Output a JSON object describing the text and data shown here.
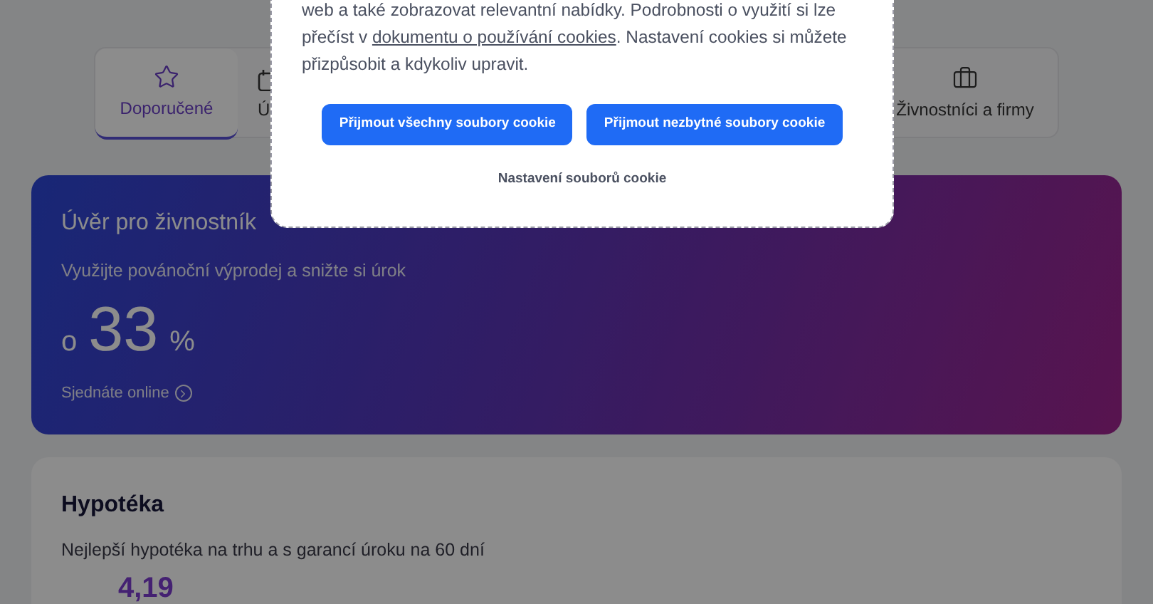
{
  "tabs": [
    {
      "label": "Doporučené",
      "selected": true
    },
    {
      "label": "Ú",
      "selected": false
    },
    {
      "label": "Živnostníci a firmy",
      "selected": false
    }
  ],
  "promo_card": {
    "title": "Úvěr pro živnostník",
    "subtitle": "Využijte povánoční výprodej a snižte si úrok",
    "prefix": "o",
    "value": "33",
    "unit": "%",
    "link": "Sjednáte online"
  },
  "mortgage_card": {
    "title": "Hypotéka",
    "subtitle": "Nejlepší hypotéka na trhu a s garancí úroku na 60 dní",
    "value": "4,19"
  },
  "cookie_dialog": {
    "text_before": "web a také zobrazovat relevantní nabídky. Podrobnosti o využití si lze přečíst v ",
    "link": "dokumentu o používání cookies",
    "text_after": ". Nastavení cookies si můžete přizpůsobit a kdykoliv upravit.",
    "buttons": [
      "Přijmout všechny soubory cookie",
      "Přijmout nezbytné soubory cookie"
    ],
    "settings_link": "Nastavení souborů cookie"
  }
}
